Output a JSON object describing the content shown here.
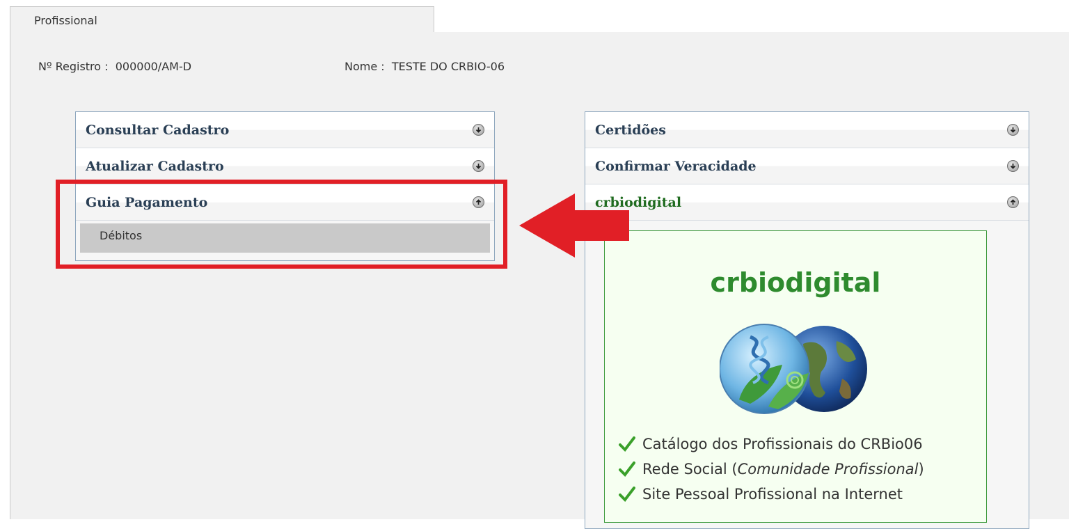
{
  "tab": {
    "label": "Profissional"
  },
  "registro": {
    "label": "Nº Registro :",
    "value": "000000/AM-D"
  },
  "nome": {
    "label": "Nome :",
    "value": "TESTE DO CRBIO-06"
  },
  "left_menu": {
    "items": [
      {
        "label": "Consultar Cadastro",
        "icon": "arrow-down-circle-icon"
      },
      {
        "label": "Atualizar Cadastro",
        "icon": "arrow-down-circle-icon"
      },
      {
        "label": "Guia Pagamento",
        "icon": "arrow-up-circle-icon",
        "expanded": true
      }
    ],
    "sub_items": [
      {
        "label": "Débitos"
      }
    ]
  },
  "right_menu": {
    "items": [
      {
        "label": "Certidões",
        "icon": "arrow-down-circle-icon"
      },
      {
        "label": "Confirmar Veracidade",
        "icon": "arrow-down-circle-icon"
      },
      {
        "label": "crbiodigital",
        "icon": "arrow-up-circle-icon",
        "expanded": true
      }
    ]
  },
  "promo": {
    "title": "crbiodigital",
    "features": [
      {
        "text": "Catálogo dos Profissionais do CRBio06"
      },
      {
        "prefix": "Rede Social (",
        "italic": "Comunidade Profissional",
        "suffix": ")"
      },
      {
        "text": "Site Pessoal Profissional na Internet"
      }
    ]
  },
  "colors": {
    "highlight": "#e11f26",
    "promo_green": "#2e8b2e",
    "header_text": "#2a3f55"
  }
}
